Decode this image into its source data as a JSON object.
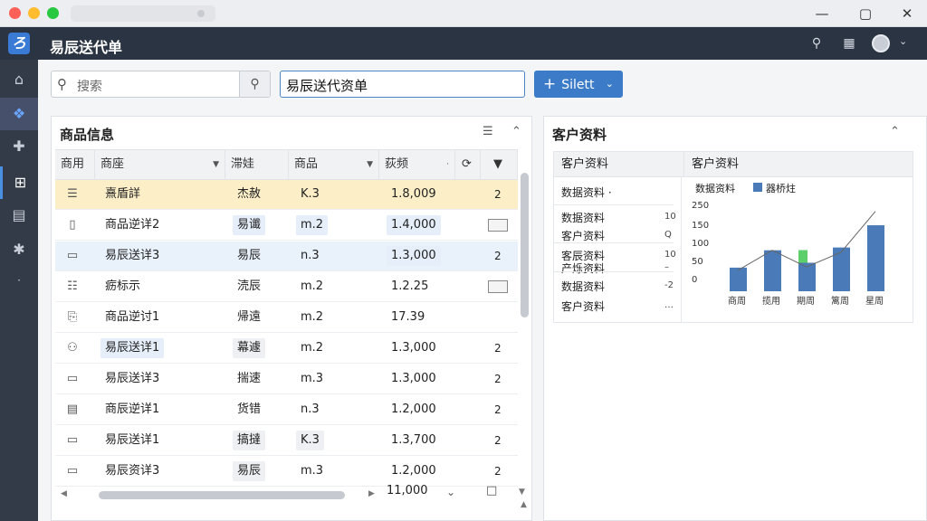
{
  "app": {
    "title": "易辰送代单",
    "logo": "ろ"
  },
  "header_icons": [
    "search-icon",
    "calendar-icon",
    "user-avatar"
  ],
  "sidebar": [
    {
      "icon": "home-icon",
      "glyph": "⌂"
    },
    {
      "icon": "gift-icon",
      "glyph": "❖"
    },
    {
      "icon": "puzzle-icon",
      "glyph": "✚"
    },
    {
      "icon": "layout-icon",
      "glyph": "⊞"
    },
    {
      "icon": "document-icon",
      "glyph": "▤"
    },
    {
      "icon": "gear-icon",
      "glyph": "✱"
    },
    {
      "icon": "dot-icon",
      "glyph": "·"
    }
  ],
  "toolbar": {
    "search_placeholder": "搜索",
    "title_value": "易辰送代资单",
    "primary_label": "Silett"
  },
  "left_panel": {
    "title": "商品信息",
    "columns": [
      "商用",
      "商座",
      "滞娃",
      "商品",
      "荻频",
      "",
      ""
    ],
    "rows": [
      {
        "name": "熹盾詳",
        "spec": "杰赦",
        "model": "K.3",
        "price": "1.8,009",
        "extra": "2"
      },
      {
        "name": "商品逆详2",
        "spec": "易谶",
        "model": "m.2",
        "price": "1.4,000",
        "extra": ""
      },
      {
        "name": "易辰送详3",
        "spec": "易辰",
        "model": "n.3",
        "price": "1.3,000",
        "extra": "2"
      },
      {
        "name": "疬标示",
        "spec": "涜辰",
        "model": "m.2",
        "price": "1.2.25",
        "extra": ""
      },
      {
        "name": "商品逆讨1",
        "spec": "帰遠",
        "model": "m.2",
        "price": "17.39",
        "extra": ""
      },
      {
        "name": "易辰送详1",
        "spec": "幕遽",
        "model": "m.2",
        "price": "1.3,000",
        "extra": "2"
      },
      {
        "name": "易辰送详3",
        "spec": "揣速",
        "model": "m.3",
        "price": "1.3,000",
        "extra": "2"
      },
      {
        "name": "商辰逆详1",
        "spec": "货错",
        "model": "n.3",
        "price": "1.2,000",
        "extra": "2"
      },
      {
        "name": "易辰送详1",
        "spec": "搞撻",
        "model": "K.3",
        "price": "1.3,700",
        "extra": "2"
      },
      {
        "name": "易辰资详3",
        "spec": "易辰",
        "model": "m.3",
        "price": "1.2,000",
        "extra": "2"
      }
    ],
    "footer_price": "11,000"
  },
  "right_panel": {
    "title": "客户资料",
    "col1": "客户资料",
    "col2": "客户资料",
    "list": [
      {
        "label": "数据资料 ·",
        "value": ""
      },
      {
        "label": "数据资料",
        "value": "10"
      },
      {
        "label": "客户资料",
        "value": "Q"
      },
      {
        "label": "客辰资料",
        "value": "10"
      },
      {
        "label": "产烁资料",
        "value": "–"
      },
      {
        "label": "数据资料",
        "value": "-2"
      },
      {
        "label": "客户资料",
        "value": "…"
      }
    ]
  },
  "chart_data": {
    "type": "bar",
    "title": "数据资料",
    "legend": "器桥炷",
    "categories": [
      "商周",
      "揽用",
      "期周",
      "篱周",
      "星周"
    ],
    "values": [
      68,
      118,
      82,
      126,
      190
    ],
    "overlay_line": [
      60,
      118,
      70,
      112,
      230
    ],
    "ylim": [
      0,
      250
    ],
    "yticks": [
      "250",
      "150",
      "100",
      "50",
      "0"
    ],
    "colors": {
      "bar": "#4a7ab8",
      "accent": "#5ccf6a",
      "line": "#666666"
    }
  }
}
